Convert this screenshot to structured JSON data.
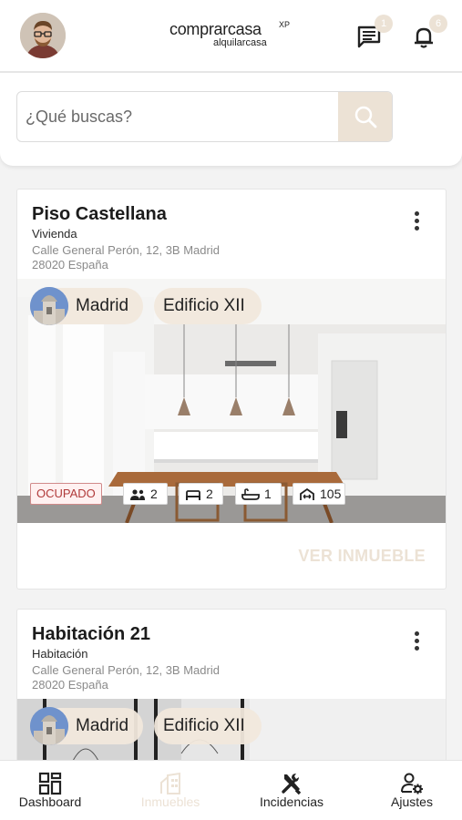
{
  "header": {
    "logo_main": "comprarcasa",
    "logo_sup": "XP",
    "logo_sub": "alquilarcasa",
    "messages_badge": "1",
    "notifications_badge": "6"
  },
  "search": {
    "placeholder": "¿Qué buscas?"
  },
  "properties": [
    {
      "title": "Piso Castellana",
      "type": "Vivienda",
      "address_line1": "Calle General Perón, 12, 3B Madrid",
      "address_line2": "28020 España",
      "city_chip": "Madrid",
      "building_chip": "Edificio XII",
      "status": "OCUPADO",
      "features": {
        "people": "2",
        "beds": "2",
        "baths": "1",
        "area": "105"
      },
      "view_label": "VER INMUEBLE"
    },
    {
      "title": "Habitación 21",
      "type": "Habitación",
      "address_line1": "Calle General Perón, 12, 3B Madrid",
      "address_line2": "28020 España",
      "city_chip": "Madrid",
      "building_chip": "Edificio XII"
    }
  ],
  "nav": {
    "items": [
      {
        "label": "Dashboard",
        "icon": "dashboard-icon"
      },
      {
        "label": "Inmuebles",
        "icon": "building-icon",
        "active": true
      },
      {
        "label": "Incidencias",
        "icon": "tools-icon"
      },
      {
        "label": "Ajustes",
        "icon": "user-settings-icon"
      }
    ]
  },
  "colors": {
    "accent": "#ece2d5",
    "status_red": "#b03a3a"
  }
}
